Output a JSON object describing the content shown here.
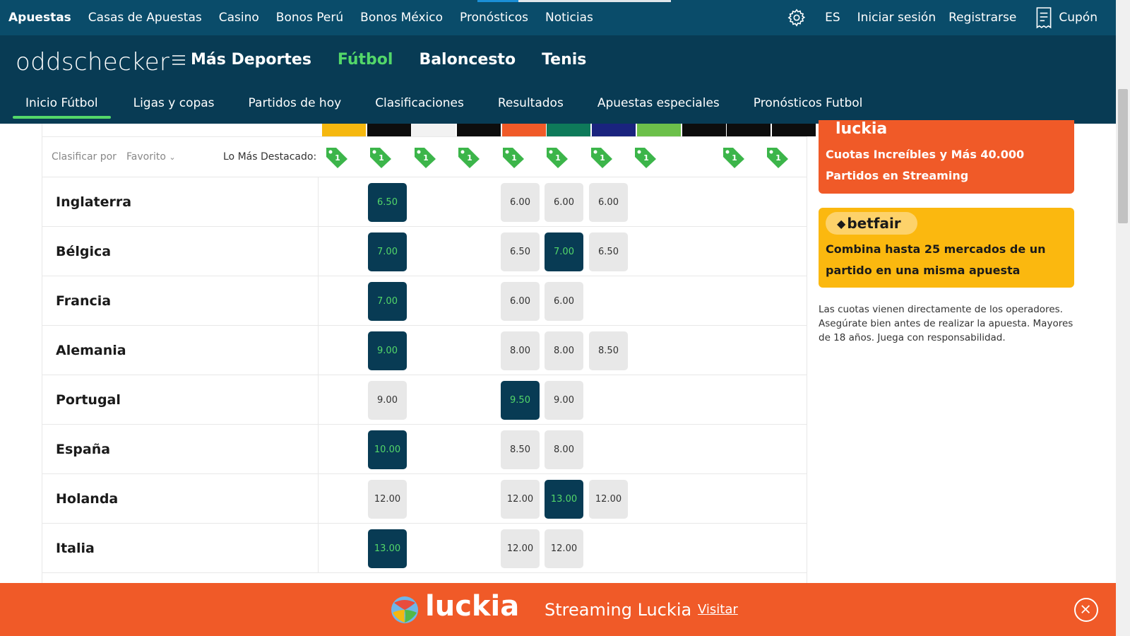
{
  "topnav": {
    "items": [
      "Apuestas",
      "Casas de Apuestas",
      "Casino",
      "Bonos Perú",
      "Bonos México",
      "Pronósticos",
      "Noticias"
    ],
    "lang": "ES",
    "login": "Iniciar sesión",
    "register": "Registrarse",
    "coupon": "Cupón"
  },
  "brand": {
    "logo": "oddschecker",
    "sports": [
      "Más Deportes",
      "Fútbol",
      "Baloncesto",
      "Tenis"
    ]
  },
  "subnav": [
    "Inicio Fútbol",
    "Ligas y copas",
    "Partidos de hoy",
    "Clasificaciones",
    "Resultados",
    "Apuestas especiales",
    "Pronósticos Futbol"
  ],
  "filters": {
    "sort_label": "Clasificar por",
    "sort_value": "Favorito",
    "highlight_label": "Lo Más Destacado:",
    "tag_value": "1"
  },
  "bookie_colors": [
    "#f5b80f",
    "#0d0d0d",
    "#f2f2f2",
    "#0d0d0d",
    "#f05a28",
    "#0e7a5a",
    "#1a237e",
    "#6cc04a",
    "#0d0d0d",
    "#0d0d0d",
    "#0d0d0d"
  ],
  "rows": [
    {
      "team": "Inglaterra",
      "odds": [
        {
          "c": 1,
          "v": "6.50",
          "best": true
        },
        {
          "c": 4,
          "v": "6.00"
        },
        {
          "c": 5,
          "v": "6.00"
        },
        {
          "c": 6,
          "v": "6.00"
        }
      ]
    },
    {
      "team": "Bélgica",
      "odds": [
        {
          "c": 1,
          "v": "7.00",
          "best": true
        },
        {
          "c": 4,
          "v": "6.50"
        },
        {
          "c": 5,
          "v": "7.00",
          "best": true
        },
        {
          "c": 6,
          "v": "6.50"
        }
      ]
    },
    {
      "team": "Francia",
      "odds": [
        {
          "c": 1,
          "v": "7.00",
          "best": true
        },
        {
          "c": 4,
          "v": "6.00"
        },
        {
          "c": 5,
          "v": "6.00"
        }
      ]
    },
    {
      "team": "Alemania",
      "odds": [
        {
          "c": 1,
          "v": "9.00",
          "best": true
        },
        {
          "c": 4,
          "v": "8.00"
        },
        {
          "c": 5,
          "v": "8.00"
        },
        {
          "c": 6,
          "v": "8.50"
        }
      ]
    },
    {
      "team": "Portugal",
      "odds": [
        {
          "c": 1,
          "v": "9.00"
        },
        {
          "c": 4,
          "v": "9.50",
          "best": true
        },
        {
          "c": 5,
          "v": "9.00"
        }
      ]
    },
    {
      "team": "España",
      "odds": [
        {
          "c": 1,
          "v": "10.00",
          "best": true
        },
        {
          "c": 4,
          "v": "8.50"
        },
        {
          "c": 5,
          "v": "8.00"
        }
      ]
    },
    {
      "team": "Holanda",
      "odds": [
        {
          "c": 1,
          "v": "12.00"
        },
        {
          "c": 4,
          "v": "12.00"
        },
        {
          "c": 5,
          "v": "13.00",
          "best": true
        },
        {
          "c": 6,
          "v": "12.00"
        }
      ]
    },
    {
      "team": "Italia",
      "odds": [
        {
          "c": 1,
          "v": "13.00",
          "best": true
        },
        {
          "c": 4,
          "v": "12.00"
        },
        {
          "c": 5,
          "v": "12.00"
        }
      ]
    }
  ],
  "sidebar": {
    "promo1_logo": "luckia",
    "promo1_text": "Cuotas Increíbles y Más 40.000 Partidos en Streaming",
    "promo2_logo": "betfair",
    "promo2_text": "Combina hasta 25 mercados de un partido en una misma apuesta",
    "disclaimer": "Las cuotas vienen directamente de los operadores. Asegúrate bien antes de realizar la apuesta. Mayores de 18 años. Juega con responsabilidad."
  },
  "banner": {
    "logo": "luckia",
    "title": "Streaming Luckia",
    "visit": "Visitar"
  },
  "colors": {
    "topbar": "#0a4c6a",
    "brandbar": "#083b54",
    "accent_green": "#53d769",
    "luckia_orange": "#f05a28",
    "betfair_yellow": "#fbb80f"
  }
}
